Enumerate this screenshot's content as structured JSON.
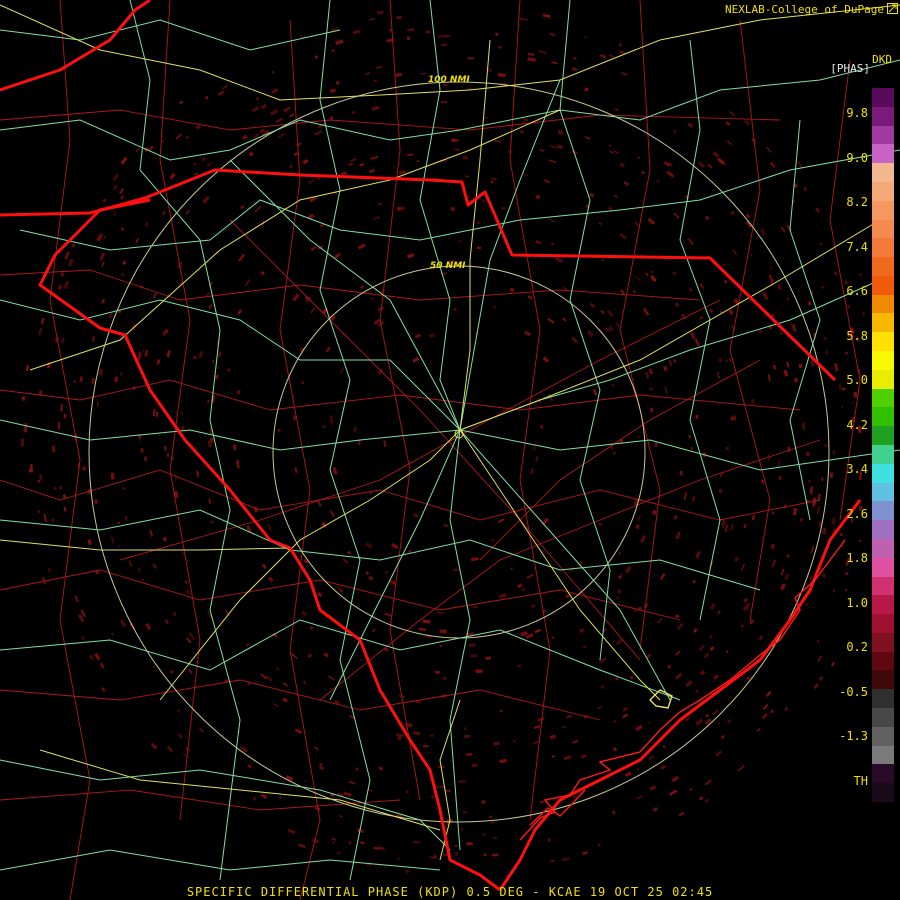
{
  "credit": "NEXLAB-College of DuPage",
  "credit_icon": "cod-logo-icon",
  "radar_id": "DKD",
  "units": "[PHAS]",
  "caption": "SPECIFIC DIFFERENTIAL PHASE (KDP) 0.5 DEG - KCAE 19 OCT 25 02:45",
  "range_rings": [
    {
      "label": "100 NMI"
    },
    {
      "label": "50 NMI"
    }
  ],
  "colorscale": {
    "ticks": [
      "9.8",
      "9.0",
      "8.2",
      "7.4",
      "6.6",
      "5.8",
      "5.0",
      "4.2",
      "3.4",
      "2.6",
      "1.8",
      "1.0",
      "0.2",
      "-0.5",
      "-1.3",
      "TH"
    ],
    "colors_top_to_bottom": [
      "#5a0a5a",
      "#7a1a7a",
      "#a03aa0",
      "#c864c8",
      "#f4b890",
      "#f5a878",
      "#f59860",
      "#f48a50",
      "#f47a3c",
      "#f06a1e",
      "#f05a0a",
      "#f08a00",
      "#f8b800",
      "#ffe000",
      "#f8f800",
      "#e8ec00",
      "#50d000",
      "#30c000",
      "#20a020",
      "#40d090",
      "#40e0e0",
      "#60c0e0",
      "#8090d0",
      "#a070c0",
      "#c060b0",
      "#e050a0",
      "#d03070",
      "#b81848",
      "#a01030",
      "#801020",
      "#600810",
      "#400808",
      "#303030",
      "#484848",
      "#606060",
      "#7a7a7a",
      "#2a0a2a"
    ],
    "color_th": "#1a0a1a"
  },
  "map_colors": {
    "state_border": "#ff1010",
    "county_lines": "#b01818",
    "highways": "#80e0a0",
    "interstates": "#e0e060",
    "range_rings": "#c8c890",
    "echo": "#8a1010"
  }
}
